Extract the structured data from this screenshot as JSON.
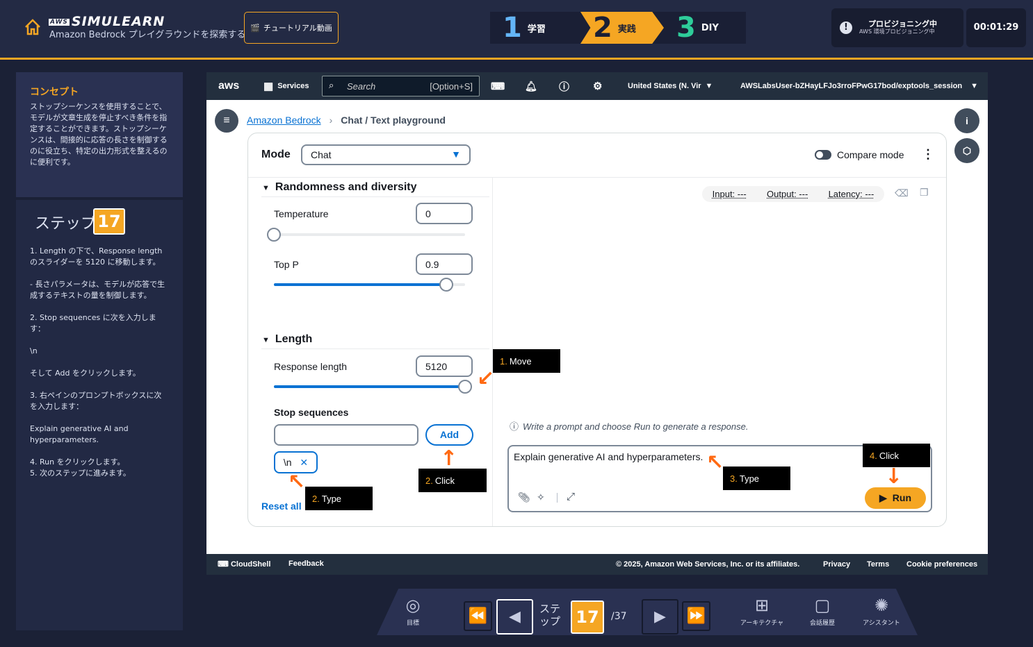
{
  "topbar": {
    "brand_aws": "AWS",
    "brand_name": "SIMULEARN",
    "subtitle": "Amazon Bedrock プレイグラウンドを探索する",
    "tutorial_label": "チュートリアル動画",
    "phases": [
      {
        "num": "1",
        "label": "学習"
      },
      {
        "num": "2",
        "label": "実践"
      },
      {
        "num": "3",
        "label": "DIY"
      }
    ],
    "provision_title": "プロビジョニング中",
    "provision_sub": "AWS 環境プロビジョニング中",
    "timer": "00:01:29"
  },
  "concept": {
    "title": "コンセプト",
    "text": "ストップシーケンスを使用することで、モデルが文章生成を停止すべき条件を指定することができます。ストップシーケンスは、間接的に応答の長さを制御するのに役立ち、特定の出力形式を整えるのに便利です。"
  },
  "step": {
    "label": "ステップ",
    "number": "17",
    "instructions": [
      "1. Length の下で、Response length のスライダーを 5120 に移動します。",
      "- 長さパラメータは、モデルが応答で生成するテキストの量を制御します。",
      "2. Stop sequences に次を入力します：",
      "\\n",
      "そして Add をクリックします。",
      "3. 右ペインのプロンプトボックスに次を入力します：",
      "Explain generative AI and hyperparameters.",
      "4. Run をクリックします。\n5. 次のステップに進みます。"
    ]
  },
  "console": {
    "nav": {
      "logo": "aws",
      "services": "Services",
      "search_placeholder": "Search",
      "search_shortcut": "[Option+S]",
      "region": "United States (N. Vir",
      "account": "AWSLabsUser-bZHayLFJo3rroFPwG17bod/exptools_session"
    },
    "breadcrumb": {
      "root": "Amazon Bedrock",
      "current": "Chat / Text playground"
    },
    "mode_label": "Mode",
    "mode_value": "Chat",
    "compare_label": "Compare mode",
    "randomness_title": "Randomness and diversity",
    "temperature_label": "Temperature",
    "temperature_value": "0",
    "temperature_slider": 0.0,
    "top_p_label": "Top P",
    "top_p_value": "0.9",
    "top_p_slider": 0.9,
    "length_title": "Length",
    "response_length_label": "Response length",
    "response_length_value": "5120",
    "response_length_slider": 1.0,
    "stop_sequences_label": "Stop sequences",
    "add_label": "Add",
    "token_value": "\\n",
    "reset_label": "Reset all",
    "metrics": {
      "input": "Input: ---",
      "output": "Output: ---",
      "latency": "Latency: ---"
    },
    "hint": "Write a prompt and choose Run to generate a response.",
    "prompt_text": "Explain generative AI and hyperparameters.",
    "run_label": "Run",
    "footer": {
      "cloudshell": "CloudShell",
      "feedback": "Feedback",
      "copyright": "© 2025, Amazon Web Services, Inc. or its affiliates.",
      "privacy": "Privacy",
      "terms": "Terms",
      "cookies": "Cookie preferences"
    }
  },
  "callouts": [
    {
      "num": "1.",
      "text": "Move"
    },
    {
      "num": "2.",
      "text": "Click"
    },
    {
      "num": "2.",
      "text": "Type"
    },
    {
      "num": "3.",
      "text": "Type"
    },
    {
      "num": "4.",
      "text": "Click"
    }
  ],
  "bottom": {
    "goal": "目標",
    "step_label": "ステップ",
    "step_number": "17",
    "total": "/37",
    "architecture": "アーキテクチャ",
    "history": "会話履歴",
    "assistant": "アシスタント"
  },
  "colors": {
    "accent": "#f5a623",
    "link": "#0972d3",
    "arrow": "#ff6a13"
  }
}
